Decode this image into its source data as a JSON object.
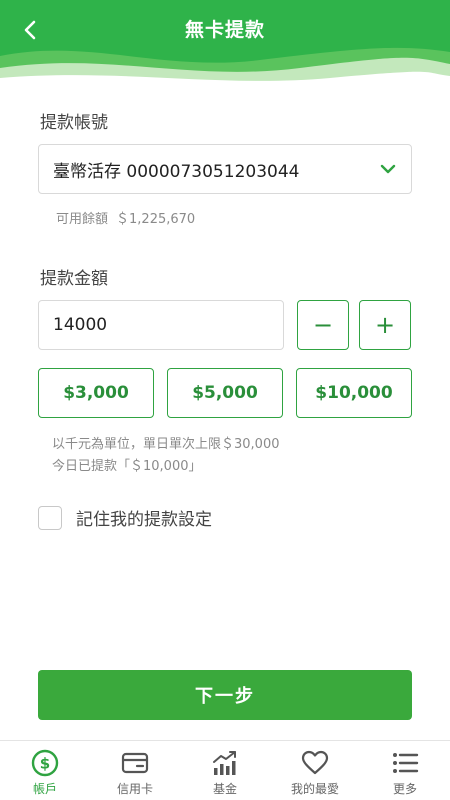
{
  "header": {
    "title": "無卡提款"
  },
  "account": {
    "label": "提款帳號",
    "selected": "臺幣活存 0000073051203044",
    "balance_label": "可用餘額",
    "balance_value": "＄1,225,670"
  },
  "amount": {
    "label": "提款金額",
    "value": "14000",
    "decrement": "−",
    "increment": "+",
    "quick": [
      "$3,000",
      "$5,000",
      "$10,000"
    ],
    "note_limit": "以千元為單位，單日單次上限＄30,000",
    "note_today": "今日已提款「＄10,000」"
  },
  "remember": {
    "label": "記住我的提款設定",
    "checked": false
  },
  "next_label": "下一步",
  "tabs": [
    {
      "label": "帳戶",
      "icon": "dollar-circle-icon",
      "active": true
    },
    {
      "label": "信用卡",
      "icon": "credit-card-icon",
      "active": false
    },
    {
      "label": "基金",
      "icon": "chart-icon",
      "active": false
    },
    {
      "label": "我的最愛",
      "icon": "heart-icon",
      "active": false
    },
    {
      "label": "更多",
      "icon": "list-icon",
      "active": false
    }
  ],
  "colors": {
    "brand": "#2fb34a",
    "button": "#3aa93c",
    "accent_text": "#2a8f3a"
  }
}
